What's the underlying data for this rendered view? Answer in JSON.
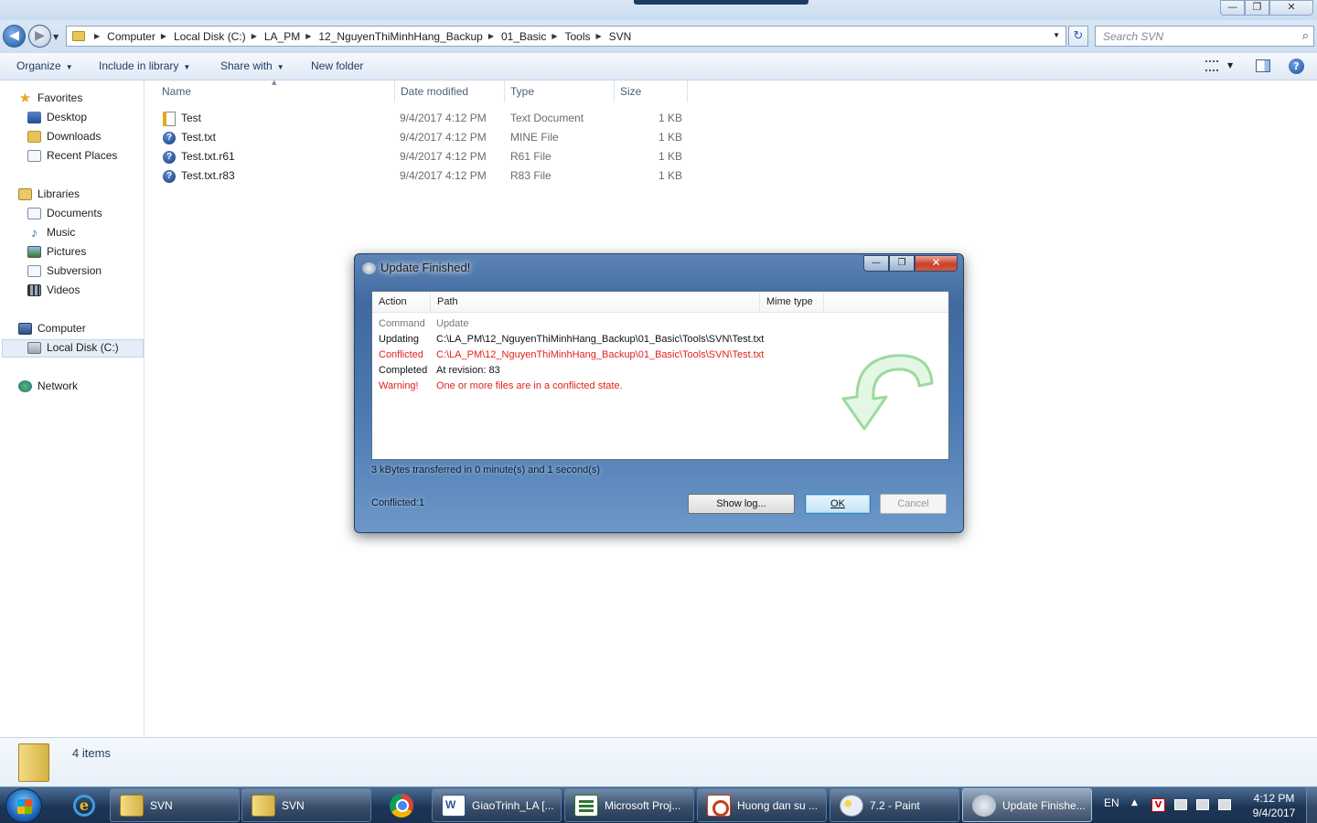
{
  "window": {
    "controls": {
      "minimize": "—",
      "maximize": "❐",
      "close": "✕"
    }
  },
  "address": {
    "crumbs": [
      "Computer",
      "Local Disk (C:)",
      "LA_PM",
      "12_NguyenThiMinhHang_Backup",
      "01_Basic",
      "Tools",
      "SVN"
    ],
    "search_placeholder": "Search SVN"
  },
  "toolbar": {
    "organize": "Organize",
    "include_in_library": "Include in library",
    "share_with": "Share with",
    "new_folder": "New folder"
  },
  "nav": {
    "favorites": {
      "label": "Favorites",
      "items": [
        "Desktop",
        "Downloads",
        "Recent Places"
      ]
    },
    "libraries": {
      "label": "Libraries",
      "items": [
        "Documents",
        "Music",
        "Pictures",
        "Subversion",
        "Videos"
      ]
    },
    "computer": {
      "label": "Computer",
      "items": [
        "Local Disk (C:)"
      ]
    },
    "network": {
      "label": "Network"
    }
  },
  "file_list": {
    "columns": [
      "Name",
      "Date modified",
      "Type",
      "Size"
    ],
    "files": [
      {
        "name": "Test",
        "date": "9/4/2017 4:12 PM",
        "type": "Text Document",
        "size": "1 KB",
        "icon": "text-file-icon"
      },
      {
        "name": "Test.txt",
        "date": "9/4/2017 4:12 PM",
        "type": "MINE File",
        "size": "1 KB",
        "icon": "unknown-file-icon"
      },
      {
        "name": "Test.txt.r61",
        "date": "9/4/2017 4:12 PM",
        "type": "R61 File",
        "size": "1 KB",
        "icon": "unknown-file-icon"
      },
      {
        "name": "Test.txt.r83",
        "date": "9/4/2017 4:12 PM",
        "type": "R83 File",
        "size": "1 KB",
        "icon": "unknown-file-icon"
      }
    ]
  },
  "details": {
    "count": "4 items"
  },
  "dialog": {
    "title": "Update Finished!",
    "columns": [
      "Action",
      "Path",
      "Mime type"
    ],
    "rows": [
      {
        "action": "Command",
        "path": "Update",
        "color": "#777777"
      },
      {
        "action": "Updating",
        "path": "C:\\LA_PM\\12_NguyenThiMinhHang_Backup\\01_Basic\\Tools\\SVN\\Test.txt",
        "color": "#111111"
      },
      {
        "action": "Conflicted",
        "path": "C:\\LA_PM\\12_NguyenThiMinhHang_Backup\\01_Basic\\Tools\\SVN\\Test.txt",
        "color": "#e0221b"
      },
      {
        "action": "Completed",
        "path": "At revision: 83",
        "color": "#111111"
      },
      {
        "action": "Warning!",
        "path": "One or more files are in a conflicted state.",
        "color": "#e0221b"
      }
    ],
    "transfer": "3 kBytes transferred in 0 minute(s) and 1 second(s)",
    "conflicted": "Conflicted:1",
    "buttons": {
      "show_log": "Show log...",
      "ok": "OK",
      "cancel": "Cancel"
    }
  },
  "taskbar": {
    "tasks": [
      "SVN",
      "SVN",
      "GiaoTrinh_LA [...",
      "Microsoft Proj...",
      "Huong dan su ...",
      "7.2 - Paint",
      "Update Finishe..."
    ],
    "lang": "EN",
    "time": "4:12 PM",
    "date": "9/4/2017"
  }
}
